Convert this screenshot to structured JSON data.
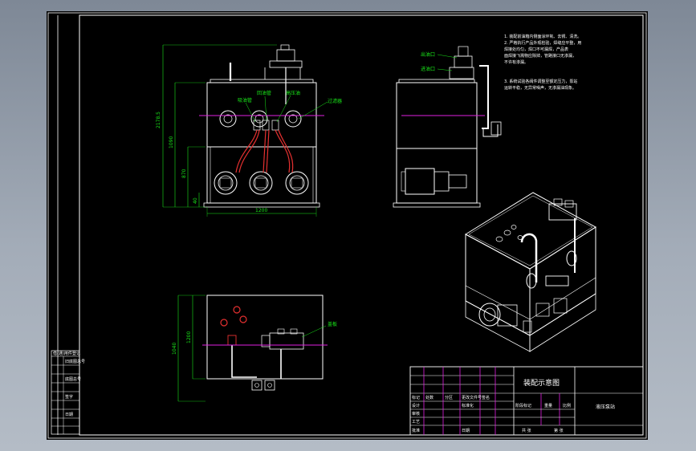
{
  "title_block": {
    "drawing_title": "装配示意图",
    "product_name": "液压泵站",
    "rows_left": [
      "标记",
      "设计",
      "审核",
      "工艺",
      "批准"
    ],
    "cols_header": [
      "处数",
      "分区",
      "更改文件号",
      "签名",
      "年月日"
    ],
    "std_check": "标准化",
    "stage_label": "阶段标记",
    "weight_label": "重量",
    "scale_label": "比例",
    "sheet_label": "共 张",
    "sheet_of": "第 张",
    "approve_date": "日期"
  },
  "left_strip": {
    "header": "借(通)用件登记",
    "rows": [
      "旧底图总号",
      "底图总号",
      "签字",
      "日期"
    ]
  },
  "notes": [
    "1. 装配前油箱内侧面涂环氧、去锈、清洗。",
    "2. 严格执行产品外观检验，焊缝应平整，用",
    "   焊接处均匀，焊口不可漏焊，产品表",
    "   面焊接飞溅物应除掉，管路接口无渗漏，",
    "   不许有渗漏。",
    "3. 系统试验各阀件调整至额定压力，泵站",
    "   运转平稳，无异常噪声，无渗漏油现象。"
  ],
  "front_view": {
    "dims": {
      "total_height": "2178.5",
      "tank_height": "1090",
      "frame_height": "870",
      "base_height": "40",
      "width": "1200"
    },
    "labels": {
      "suction": "吸油管",
      "return": "回油管",
      "pressure": "高压油",
      "filter": "过滤器"
    }
  },
  "side_view": {
    "labels": {
      "outlet": "出油口",
      "inlet": "进油口"
    }
  },
  "top_view": {
    "dims": {
      "depth_total": "1040",
      "depth_tank": "1200"
    },
    "labels": {
      "cover": "盖板"
    }
  },
  "colors": {
    "line": "#ffffff",
    "dim": "#19e619",
    "pipe": "#e53030",
    "center": "#e020e0",
    "background": "#000000"
  }
}
